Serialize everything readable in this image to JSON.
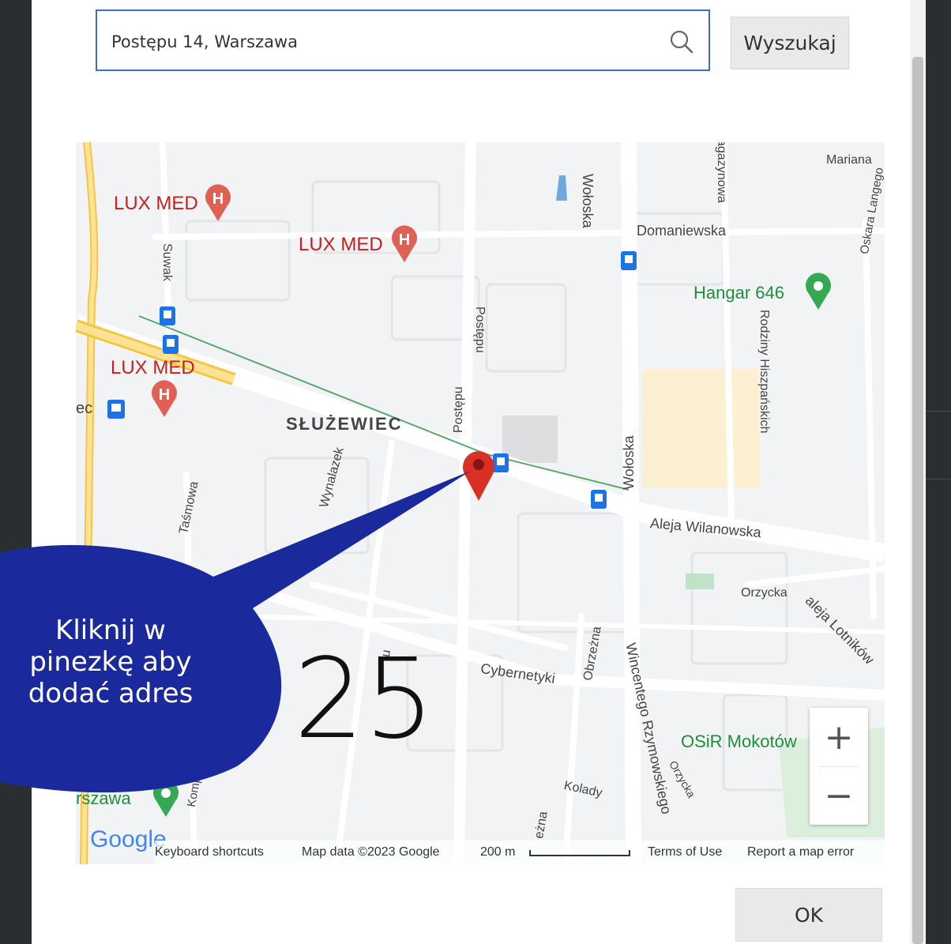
{
  "search": {
    "value": "Postępu 14, Warszawa",
    "button_label": "Wyszukaj"
  },
  "map": {
    "pois": {
      "luxmed_1": "LUX MED",
      "luxmed_2": "LUX MED",
      "luxmed_3": "LUX MED",
      "hangar": "Hangar 646",
      "osir": "OSiR Mokotów",
      "warszawa_partial": "rszawa"
    },
    "district": "SŁUŻEWIEC",
    "streets": {
      "woloska_top": "Wołoska",
      "woloska_mid": "Wołoska",
      "mariana": "Mariana",
      "domaniewska": "Domaniewska",
      "suwak": "Suwak",
      "postepu_1": "Postępu",
      "postepu_2": "Postępu",
      "wynalazek": "Wynalazek",
      "tasmowa": "Taśmowa",
      "aleja_wilanowska": "Aleja Wilanowska",
      "rodziny": "Rodziny Hiszpańskich",
      "oskara": "Oskara Langego",
      "orzycka": "Orzycka",
      "orzycka_2": "Orzycka",
      "aleja_lotnikow": "aleja Lotników",
      "cybernetyki": "Cybernetyki",
      "obrzezna": "Obrzeżna",
      "wincentego": "Wincentego Rzymowskiego",
      "kolady": "Kolady",
      "ec": "ec",
      "kompu": "Komp",
      "bagazynowa": "agazynowa",
      "u_partial": "u",
      "ezna": "eżna"
    },
    "zoom_in": "+",
    "zoom_out": "−",
    "footer": {
      "keyboard_shortcuts": "Keyboard shortcuts",
      "map_data": "Map data ©2023 Google",
      "scale": "200 m",
      "terms": "Terms of Use",
      "report": "Report a map error"
    },
    "google_logo": "Google"
  },
  "callout": {
    "line1": "Kliknij w",
    "line2": "pinezkę aby",
    "line3": "dodać adres"
  },
  "step_number": "25",
  "ok_label": "OK",
  "colors": {
    "callout": "#1a2a9c",
    "pin": "#d93025",
    "search_border": "#3b6fbf"
  },
  "icons": {
    "search": "search-icon",
    "pin": "map-pin-icon",
    "hospital": "hospital-marker-icon",
    "transit": "tram-stop-icon",
    "place": "green-place-marker-icon"
  }
}
